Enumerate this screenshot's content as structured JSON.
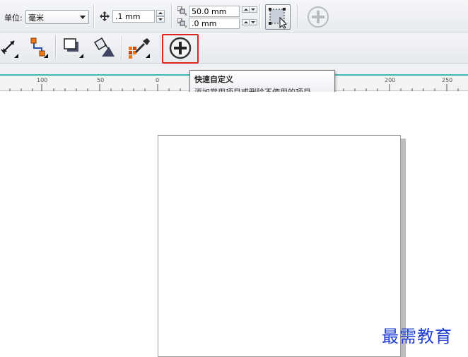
{
  "toolbar_property": {
    "unit_label": "单位:",
    "unit_value": "毫米",
    "nudge_value": ".1 mm",
    "dup_x_value": "50.0 mm",
    "dup_y_value": ".0 mm"
  },
  "ruler": {
    "ticks": [
      "100",
      "50",
      "0",
      "200",
      "250"
    ]
  },
  "tooltip": {
    "title": "快速自定义",
    "description": "添加常用项目或删除不使用的项目。"
  },
  "watermark": "最需教育",
  "colors": {
    "accent_teal": "#3fb7b4",
    "highlight_red": "#e02424",
    "watermark_blue": "#1f3fd6"
  }
}
